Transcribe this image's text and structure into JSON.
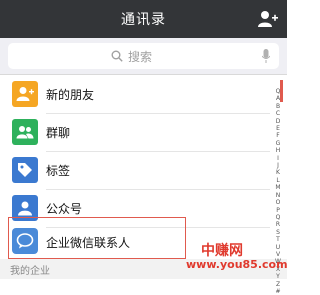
{
  "nav": {
    "title": "通讯录",
    "add_icon": "add-user-icon"
  },
  "search": {
    "placeholder": "搜索",
    "icon": "search-icon",
    "voice_icon": "microphone-icon"
  },
  "rows": [
    {
      "label": "新的朋友",
      "icon": "new-friend-icon",
      "color": "#f5a623"
    },
    {
      "label": "群聊",
      "icon": "group-chat-icon",
      "color": "#2eb15c"
    },
    {
      "label": "标签",
      "icon": "tag-icon",
      "color": "#3b79d0"
    },
    {
      "label": "公众号",
      "icon": "official-account-icon",
      "color": "#3b79d0"
    },
    {
      "label": "企业微信联系人",
      "icon": "wecom-contact-icon",
      "color": "#4a8ad8"
    }
  ],
  "section": {
    "label": "我的企业"
  },
  "index_letters": [
    "Q",
    "A",
    "B",
    "C",
    "D",
    "E",
    "F",
    "G",
    "H",
    "I",
    "J",
    "K",
    "L",
    "M",
    "N",
    "O",
    "P",
    "Q",
    "R",
    "S",
    "T",
    "U",
    "V",
    "W",
    "X",
    "Y",
    "Z",
    "#"
  ],
  "watermark": {
    "logo": "中赚网",
    "url": "www.you85.com"
  },
  "colors": {
    "nav_bg": "#333538",
    "highlight": "#e05a4e",
    "watermark": "#e03a2e"
  }
}
